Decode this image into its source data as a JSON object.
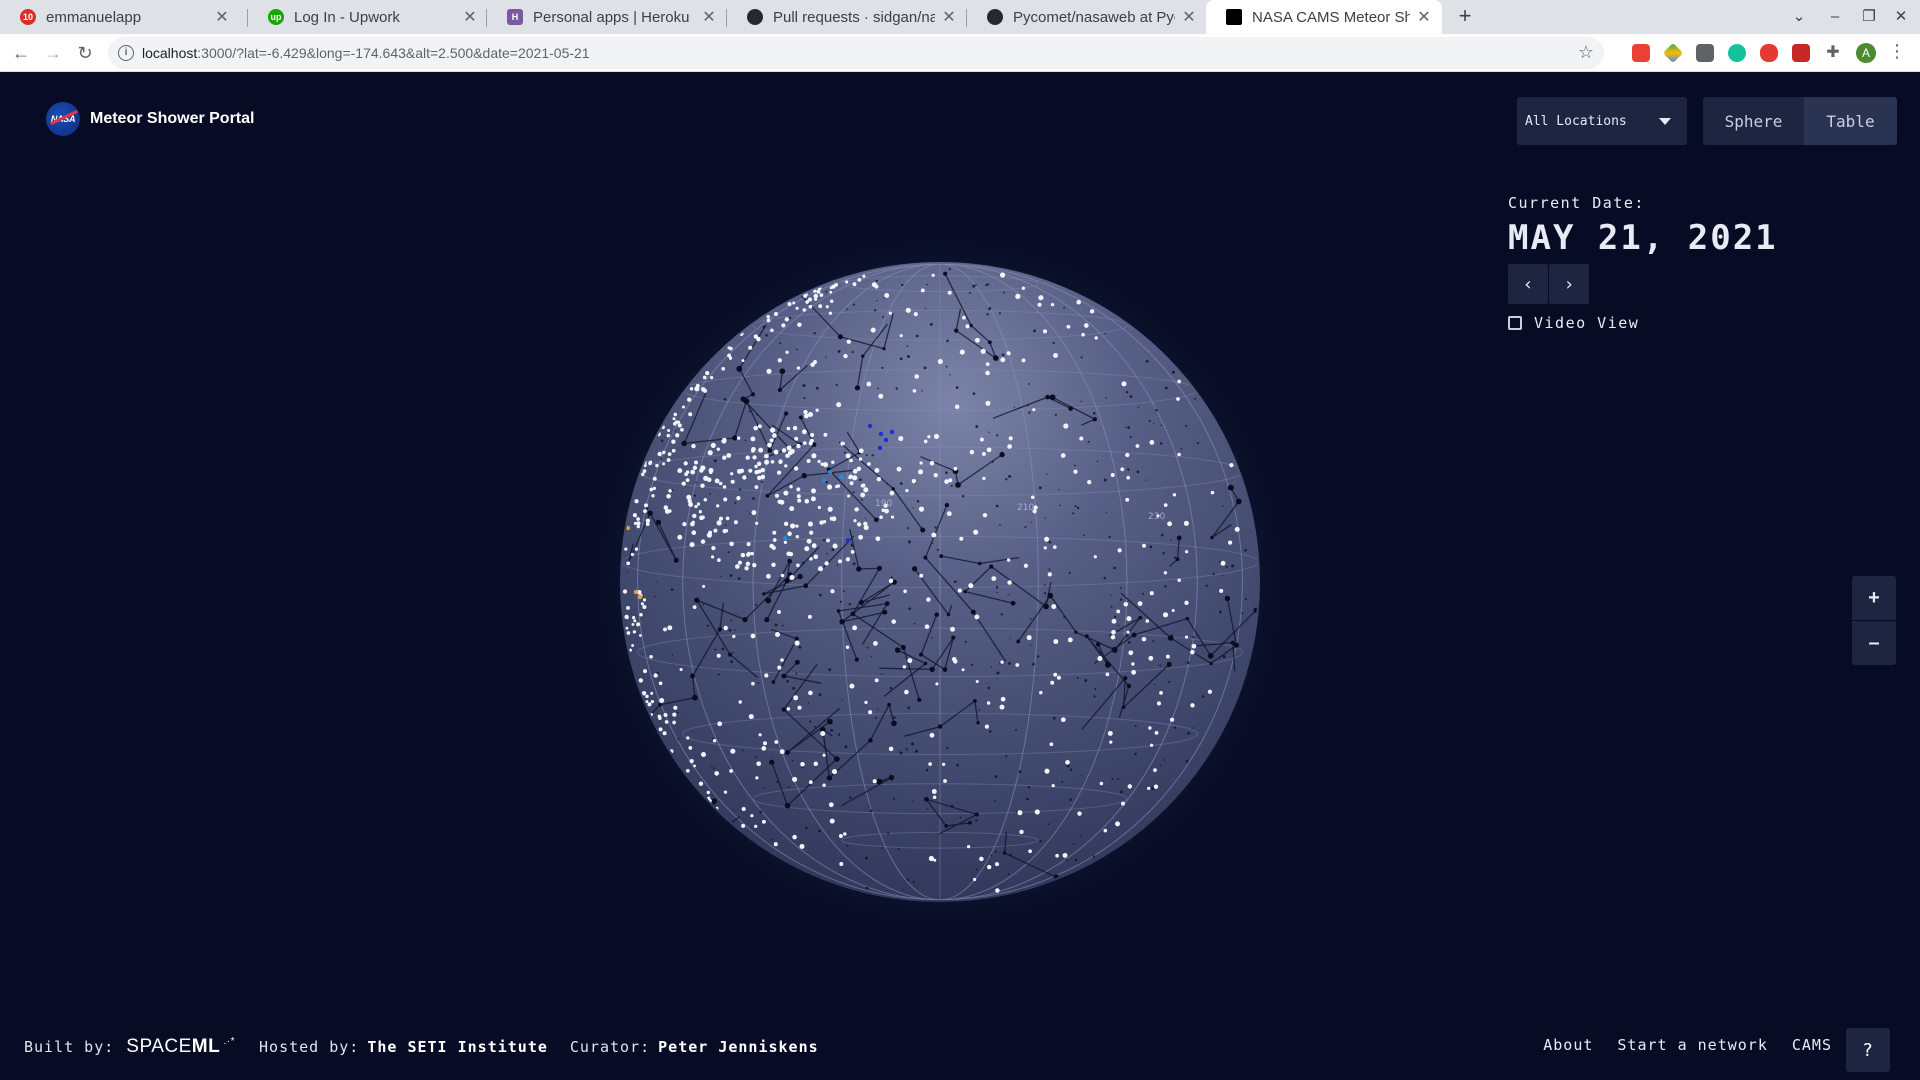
{
  "browser": {
    "tabs": [
      {
        "title": "emmanuelapp",
        "favicon_color": "#d93025",
        "favicon_text": "10"
      },
      {
        "title": "Log In - Upwork",
        "favicon_color": "#14a800",
        "favicon_text": "up"
      },
      {
        "title": "Personal apps | Heroku",
        "favicon_color": "#79589f",
        "favicon_text": "H"
      },
      {
        "title": "Pull requests · sidgan/nas",
        "favicon_color": "#24292e",
        "favicon_text": ""
      },
      {
        "title": "Pycomet/nasaweb at Pyc",
        "favicon_color": "#24292e",
        "favicon_text": ""
      },
      {
        "title": "NASA CAMS Meteor Show",
        "favicon_color": "#000000",
        "favicon_text": ""
      }
    ],
    "active_tab": 5,
    "url_host": "localhost",
    "url_path": ":3000/?lat=-6.429&long=-174.643&alt=2.500&date=2021-05-21",
    "profile_initial": "A"
  },
  "header": {
    "logo_badge": "NASA",
    "title": "Meteor Shower Portal",
    "location_select": "All Locations",
    "view_sphere": "Sphere",
    "view_table": "Table"
  },
  "date_panel": {
    "label": "Current Date:",
    "value": "MAY 21, 2021",
    "prev": "‹",
    "next": "›",
    "video_view": "Video View",
    "video_view_checked": false
  },
  "zoom": {
    "in": "+",
    "out": "–"
  },
  "globe": {
    "grid_labels": [
      "190",
      "210",
      "230"
    ],
    "sphere_color": "#4a5178",
    "glow_color": "#9aa8d8"
  },
  "footer": {
    "built_by_label": "Built by:",
    "built_by_value_a": "SPACE",
    "built_by_value_b": "ML",
    "hosted_by_label": "Hosted by:",
    "hosted_by_value": "The SETI Institute",
    "curator_label": "Curator:",
    "curator_value": "Peter Jenniskens",
    "links": [
      "About",
      "Start a network",
      "CAMS"
    ],
    "help": "?"
  },
  "colors": {
    "page_bg": "#070c24",
    "panel_bg": "#1d2540",
    "text": "#e8ebf5"
  }
}
